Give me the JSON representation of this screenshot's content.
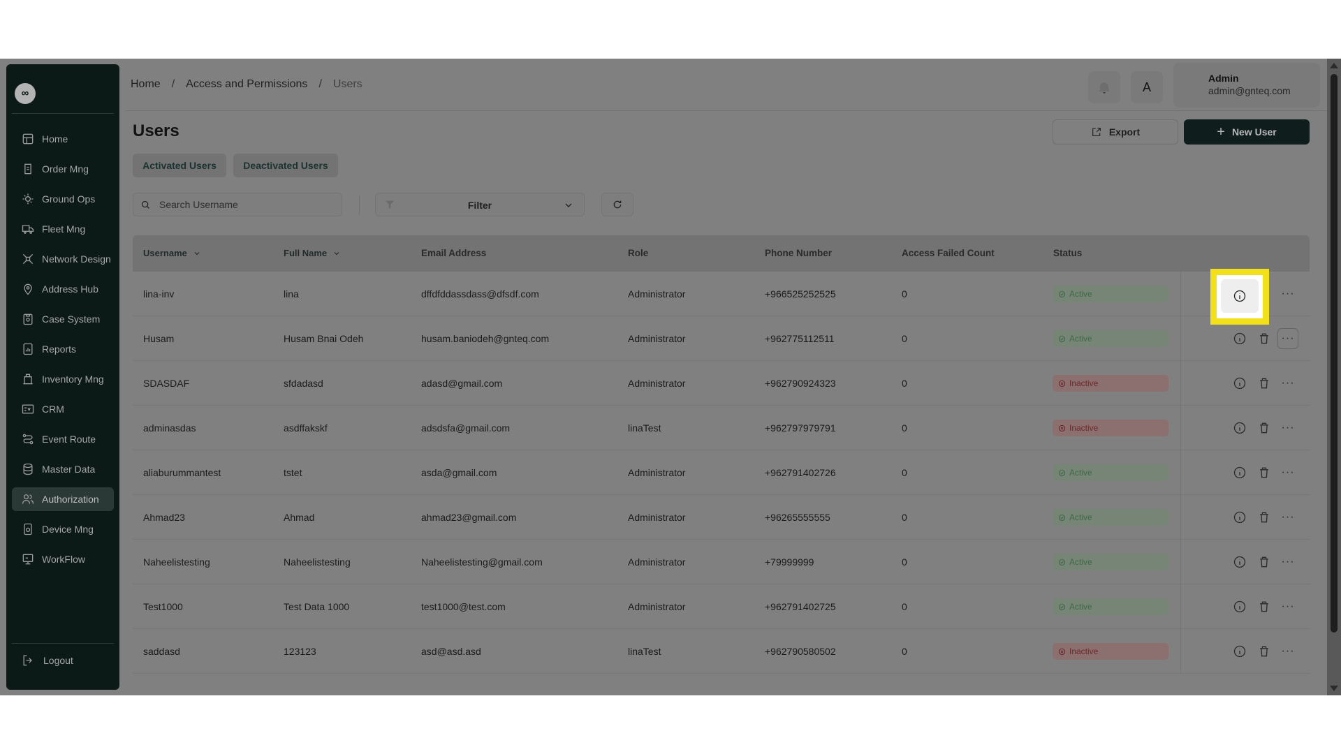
{
  "sidebar": {
    "logo_text": "∞",
    "items": [
      {
        "label": "Home",
        "icon": "layout-icon"
      },
      {
        "label": "Order Mng",
        "icon": "order-icon"
      },
      {
        "label": "Ground Ops",
        "icon": "ground-ops-icon"
      },
      {
        "label": "Fleet Mng",
        "icon": "truck-icon"
      },
      {
        "label": "Network Design",
        "icon": "network-icon"
      },
      {
        "label": "Address Hub",
        "icon": "location-icon"
      },
      {
        "label": "Case System",
        "icon": "case-icon"
      },
      {
        "label": "Reports",
        "icon": "report-icon"
      },
      {
        "label": "Inventory Mng",
        "icon": "inventory-icon"
      },
      {
        "label": "CRM",
        "icon": "crm-icon"
      },
      {
        "label": "Event Route",
        "icon": "route-icon"
      },
      {
        "label": "Master Data",
        "icon": "database-icon"
      },
      {
        "label": "Authorization",
        "icon": "users-icon",
        "active": true
      },
      {
        "label": "Device Mng",
        "icon": "device-icon"
      },
      {
        "label": "WorkFlow",
        "icon": "workflow-icon"
      }
    ],
    "logout_label": "Logout"
  },
  "header": {
    "breadcrumb": [
      "Home",
      "Access and Permissions",
      "Users"
    ],
    "separator": "/",
    "user_name": "Admin",
    "user_email": "admin@gnteq.com",
    "lang_label": "A"
  },
  "page": {
    "title": "Users",
    "export_label": "Export",
    "new_user_label": "New User",
    "tabs": [
      "Activated Users",
      "Deactivated Users"
    ],
    "search_placeholder": "Search Username",
    "filter_label": "Filter"
  },
  "table": {
    "columns": [
      "Username",
      "Full Name",
      "Email Address",
      "Role",
      "Phone Number",
      "Access Failed Count",
      "Status"
    ],
    "rows": [
      {
        "username": "lina-inv",
        "full_name": "lina",
        "email": "dffdfddassdass@dfsdf.com",
        "role": "Administrator",
        "phone": "+966525252525",
        "failed": "0",
        "status": "Active"
      },
      {
        "username": "Husam",
        "full_name": "Husam Bnai Odeh",
        "email": "husam.baniodeh@gnteq.com",
        "role": "Administrator",
        "phone": "+962775112511",
        "failed": "0",
        "status": "Active"
      },
      {
        "username": "SDASDAF",
        "full_name": "sfdadasd",
        "email": "adasd@gmail.com",
        "role": "Administrator",
        "phone": "+962790924323",
        "failed": "0",
        "status": "Inactive"
      },
      {
        "username": "adminasdas",
        "full_name": "asdffakskf",
        "email": "adsdsfa@gmail.com",
        "role": "linaTest",
        "phone": "+962797979791",
        "failed": "0",
        "status": "Inactive"
      },
      {
        "username": "aliaburummantest",
        "full_name": "tstet",
        "email": "asda@gmail.com",
        "role": "Administrator",
        "phone": "+962791402726",
        "failed": "0",
        "status": "Active"
      },
      {
        "username": "Ahmad23",
        "full_name": "Ahmad",
        "email": "ahmad23@gmail.com",
        "role": "Administrator",
        "phone": "+96265555555",
        "failed": "0",
        "status": "Active"
      },
      {
        "username": "Naheelistesting",
        "full_name": "Naheelistesting",
        "email": "Naheelistesting@gmail.com",
        "role": "Administrator",
        "phone": "+79999999",
        "failed": "0",
        "status": "Active"
      },
      {
        "username": "Test1000",
        "full_name": "Test Data 1000",
        "email": "test1000@test.com",
        "role": "Administrator",
        "phone": "+962791402725",
        "failed": "0",
        "status": "Active"
      },
      {
        "username": "saddasd",
        "full_name": "123123",
        "email": "asd@asd.asd",
        "role": "linaTest",
        "phone": "+962790580502",
        "failed": "0",
        "status": "Inactive"
      }
    ]
  },
  "colors": {
    "overlay": "#808080",
    "sidebar": "#0b1917",
    "primary_button": "#0f1d1c",
    "highlight": "#f2e01a",
    "active_status": "#3e6a45",
    "inactive_status": "#6a2a2a"
  }
}
